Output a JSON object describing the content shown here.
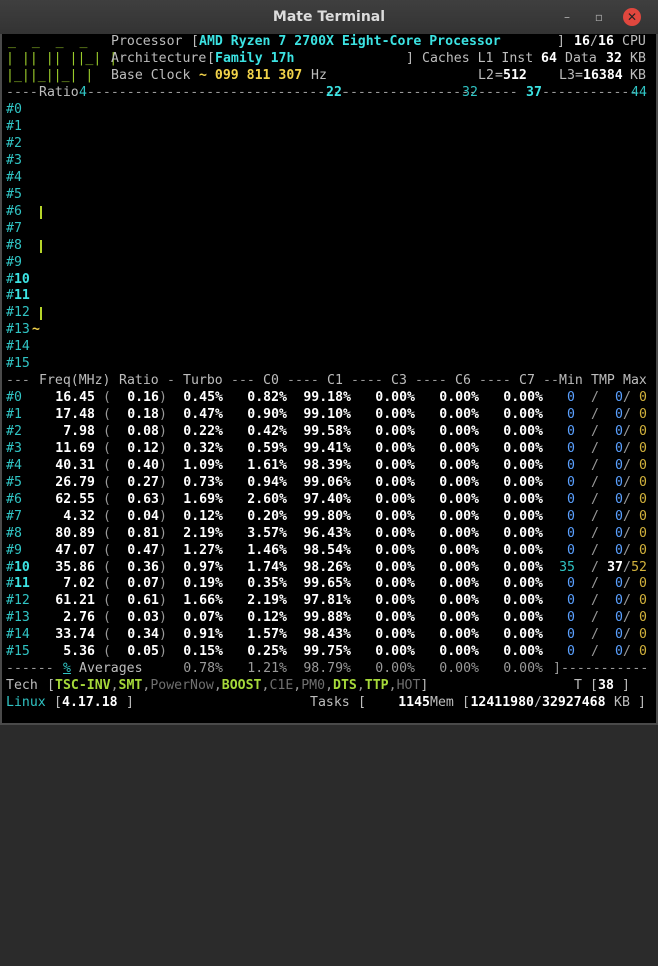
{
  "window": {
    "title": "Mate Terminal",
    "buttons": [
      "–",
      "▫",
      "✕"
    ]
  },
  "header": {
    "processor_label": "Processor",
    "processor_value": "AMD Ryzen 7 2700X Eight-Core Processor",
    "threads_online": "16",
    "threads_total": "16",
    "cpu_label": "CPU",
    "arch_label": "Architecture",
    "arch_value": "Family 17h",
    "caches_label": "Caches L1 Inst",
    "l1_inst": "64",
    "data_label": "Data",
    "l1_data": "32",
    "kb": "KB",
    "base_clock_label": "Base Clock",
    "base_clock_value": "~ 099 811 307",
    "hz": "Hz",
    "l2_label": "L2",
    "l2_value": "512",
    "l3_label": "L3",
    "l3_value": "16384",
    "logo_lines": [
      "_  _  _  _",
      "| || || ||_| |",
      "|_||_||_| |"
    ]
  },
  "ratio_ruler": {
    "label": "Ratio",
    "marks": [
      "4",
      "22",
      "32",
      "37",
      "44"
    ]
  },
  "cores": [
    "#0",
    "#1",
    "#2",
    "#3",
    "#4",
    "#5",
    "#6",
    "#7",
    "#8",
    "#9",
    "#10",
    "#11",
    "#12",
    "#13",
    "#14",
    "#15"
  ],
  "table": {
    "headers": [
      "Freq(MHz)",
      "Ratio",
      "Turbo",
      "C0",
      "C1",
      "C3",
      "C6",
      "C7",
      "Min",
      "TMP",
      "Max"
    ],
    "rows": [
      {
        "core": "#0",
        "freq": "16.45",
        "ratio": "0.16",
        "turbo": "0.45%",
        "c0": "0.82%",
        "c1": "99.18%",
        "c3": "0.00%",
        "c6": "0.00%",
        "c7": "0.00%",
        "min": "0",
        "tmp": "0",
        "max": "0"
      },
      {
        "core": "#1",
        "freq": "17.48",
        "ratio": "0.18",
        "turbo": "0.47%",
        "c0": "0.90%",
        "c1": "99.10%",
        "c3": "0.00%",
        "c6": "0.00%",
        "c7": "0.00%",
        "min": "0",
        "tmp": "0",
        "max": "0"
      },
      {
        "core": "#2",
        "freq": "7.98",
        "ratio": "0.08",
        "turbo": "0.22%",
        "c0": "0.42%",
        "c1": "99.58%",
        "c3": "0.00%",
        "c6": "0.00%",
        "c7": "0.00%",
        "min": "0",
        "tmp": "0",
        "max": "0"
      },
      {
        "core": "#3",
        "freq": "11.69",
        "ratio": "0.12",
        "turbo": "0.32%",
        "c0": "0.59%",
        "c1": "99.41%",
        "c3": "0.00%",
        "c6": "0.00%",
        "c7": "0.00%",
        "min": "0",
        "tmp": "0",
        "max": "0"
      },
      {
        "core": "#4",
        "freq": "40.31",
        "ratio": "0.40",
        "turbo": "1.09%",
        "c0": "1.61%",
        "c1": "98.39%",
        "c3": "0.00%",
        "c6": "0.00%",
        "c7": "0.00%",
        "min": "0",
        "tmp": "0",
        "max": "0"
      },
      {
        "core": "#5",
        "freq": "26.79",
        "ratio": "0.27",
        "turbo": "0.73%",
        "c0": "0.94%",
        "c1": "99.06%",
        "c3": "0.00%",
        "c6": "0.00%",
        "c7": "0.00%",
        "min": "0",
        "tmp": "0",
        "max": "0"
      },
      {
        "core": "#6",
        "freq": "62.55",
        "ratio": "0.63",
        "turbo": "1.69%",
        "c0": "2.60%",
        "c1": "97.40%",
        "c3": "0.00%",
        "c6": "0.00%",
        "c7": "0.00%",
        "min": "0",
        "tmp": "0",
        "max": "0"
      },
      {
        "core": "#7",
        "freq": "4.32",
        "ratio": "0.04",
        "turbo": "0.12%",
        "c0": "0.20%",
        "c1": "99.80%",
        "c3": "0.00%",
        "c6": "0.00%",
        "c7": "0.00%",
        "min": "0",
        "tmp": "0",
        "max": "0"
      },
      {
        "core": "#8",
        "freq": "80.89",
        "ratio": "0.81",
        "turbo": "2.19%",
        "c0": "3.57%",
        "c1": "96.43%",
        "c3": "0.00%",
        "c6": "0.00%",
        "c7": "0.00%",
        "min": "0",
        "tmp": "0",
        "max": "0"
      },
      {
        "core": "#9",
        "freq": "47.07",
        "ratio": "0.47",
        "turbo": "1.27%",
        "c0": "1.46%",
        "c1": "98.54%",
        "c3": "0.00%",
        "c6": "0.00%",
        "c7": "0.00%",
        "min": "0",
        "tmp": "0",
        "max": "0"
      },
      {
        "core": "#10",
        "freq": "35.86",
        "ratio": "0.36",
        "turbo": "0.97%",
        "c0": "1.74%",
        "c1": "98.26%",
        "c3": "0.00%",
        "c6": "0.00%",
        "c7": "0.00%",
        "min": "35",
        "tmp": "37",
        "max": "52"
      },
      {
        "core": "#11",
        "freq": "7.02",
        "ratio": "0.07",
        "turbo": "0.19%",
        "c0": "0.35%",
        "c1": "99.65%",
        "c3": "0.00%",
        "c6": "0.00%",
        "c7": "0.00%",
        "min": "0",
        "tmp": "0",
        "max": "0"
      },
      {
        "core": "#12",
        "freq": "61.21",
        "ratio": "0.61",
        "turbo": "1.66%",
        "c0": "2.19%",
        "c1": "97.81%",
        "c3": "0.00%",
        "c6": "0.00%",
        "c7": "0.00%",
        "min": "0",
        "tmp": "0",
        "max": "0"
      },
      {
        "core": "#13",
        "freq": "2.76",
        "ratio": "0.03",
        "turbo": "0.07%",
        "c0": "0.12%",
        "c1": "99.88%",
        "c3": "0.00%",
        "c6": "0.00%",
        "c7": "0.00%",
        "min": "0",
        "tmp": "0",
        "max": "0"
      },
      {
        "core": "#14",
        "freq": "33.74",
        "ratio": "0.34",
        "turbo": "0.91%",
        "c0": "1.57%",
        "c1": "98.43%",
        "c3": "0.00%",
        "c6": "0.00%",
        "c7": "0.00%",
        "min": "0",
        "tmp": "0",
        "max": "0"
      },
      {
        "core": "#15",
        "freq": "5.36",
        "ratio": "0.05",
        "turbo": "0.15%",
        "c0": "0.25%",
        "c1": "99.75%",
        "c3": "0.00%",
        "c6": "0.00%",
        "c7": "0.00%",
        "min": "0",
        "tmp": "0",
        "max": "0"
      }
    ],
    "averages": {
      "label": "Averages",
      "turbo": "0.78%",
      "c0": "1.21%",
      "c1": "98.79%",
      "c3": "0.00%",
      "c6": "0.00%",
      "c7": "0.00%"
    }
  },
  "ratio_bars": [
    {
      "core": 6,
      "ratio": 4
    },
    {
      "core": 8,
      "ratio": 4
    },
    {
      "core": 12,
      "ratio": 4
    }
  ],
  "ratio_tilde_core": 13,
  "footer": {
    "tech_label": "Tech",
    "tech_items": [
      {
        "name": "TSC-INV",
        "on": true
      },
      {
        "name": "SMT",
        "on": true
      },
      {
        "name": "PowerNow",
        "on": false
      },
      {
        "name": "BOOST",
        "on": true
      },
      {
        "name": "C1E",
        "on": false
      },
      {
        "name": "PM0",
        "on": false
      },
      {
        "name": "DTS",
        "on": true
      },
      {
        "name": "TTP",
        "on": true
      },
      {
        "name": "HOT",
        "on": false
      }
    ],
    "t_label": "T",
    "t_value": "38",
    "os_name": "Linux",
    "kernel": "4.17.18",
    "tasks_label": "Tasks",
    "tasks_value": "1145",
    "mem_label": "Mem",
    "mem_used": "12411980",
    "mem_total": "32927468",
    "mem_unit": "KB"
  },
  "colors": {
    "cyan": "#30c4c4",
    "yellow": "#f2d34a",
    "green": "#a6d93a",
    "blue": "#5aa0ff",
    "close": "#e0473e"
  }
}
